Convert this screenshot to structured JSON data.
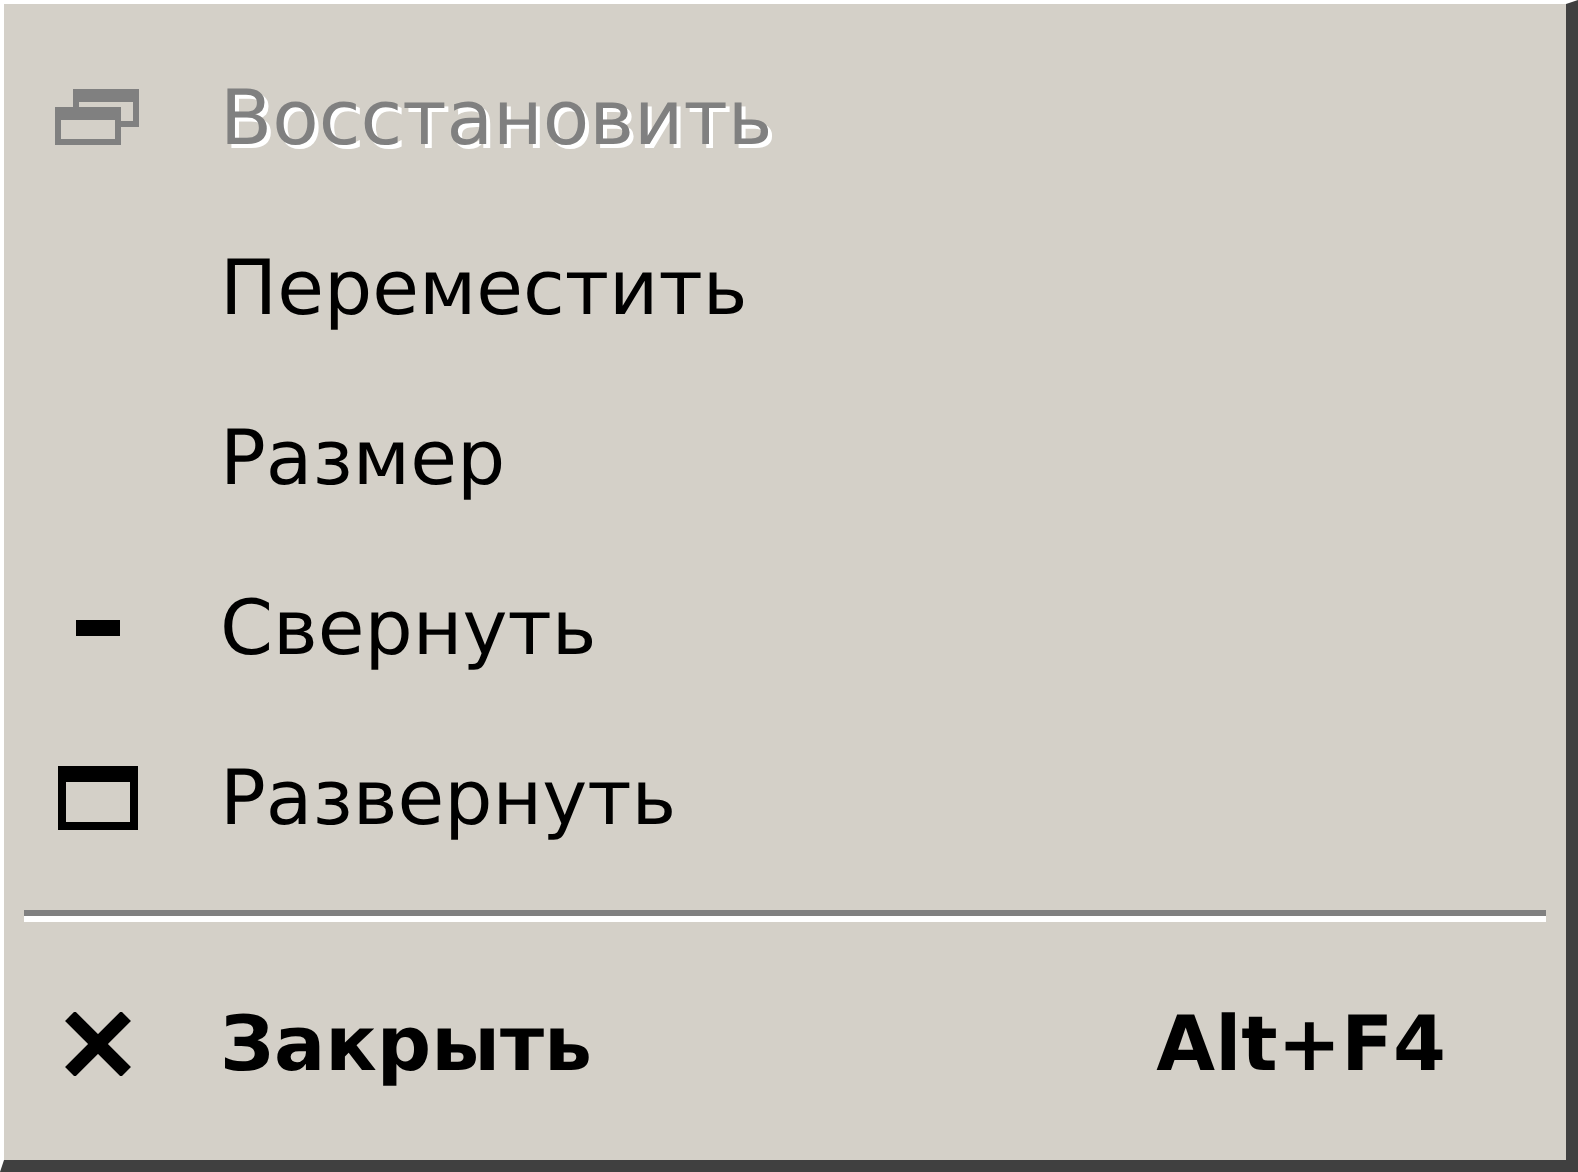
{
  "menu": {
    "items": [
      {
        "kind": "restore",
        "label": "Восстановить",
        "disabled": true,
        "default": false
      },
      {
        "kind": "move",
        "label": "Переместить",
        "disabled": false,
        "default": false
      },
      {
        "kind": "size",
        "label": "Размер",
        "disabled": false,
        "default": false
      },
      {
        "kind": "minimize",
        "label": "Свернуть",
        "disabled": false,
        "default": false
      },
      {
        "kind": "maximize",
        "label": "Развернуть",
        "disabled": false,
        "default": false
      },
      {
        "kind": "separator"
      },
      {
        "kind": "close",
        "label": "Закрыть",
        "disabled": false,
        "default": true,
        "shortcut": "Alt+F4"
      }
    ]
  }
}
